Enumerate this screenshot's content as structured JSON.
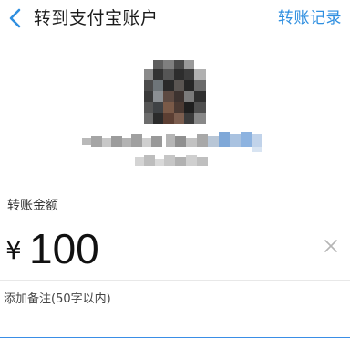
{
  "nav": {
    "title": "转到支付宝账户",
    "action_label": "转账记录",
    "back_icon": "chevron-left-icon"
  },
  "recipient": {
    "avatar": "pixelated-avatar",
    "name_obscured": true
  },
  "form": {
    "amount_label": "转账金额",
    "currency_symbol": "¥",
    "amount_value": "100",
    "clear_icon": "close-icon",
    "remark_placeholder": "添加备注(50字以内)"
  },
  "colors": {
    "accent": "#2f8fe0",
    "bottom_bar": "#3a8ee6"
  }
}
